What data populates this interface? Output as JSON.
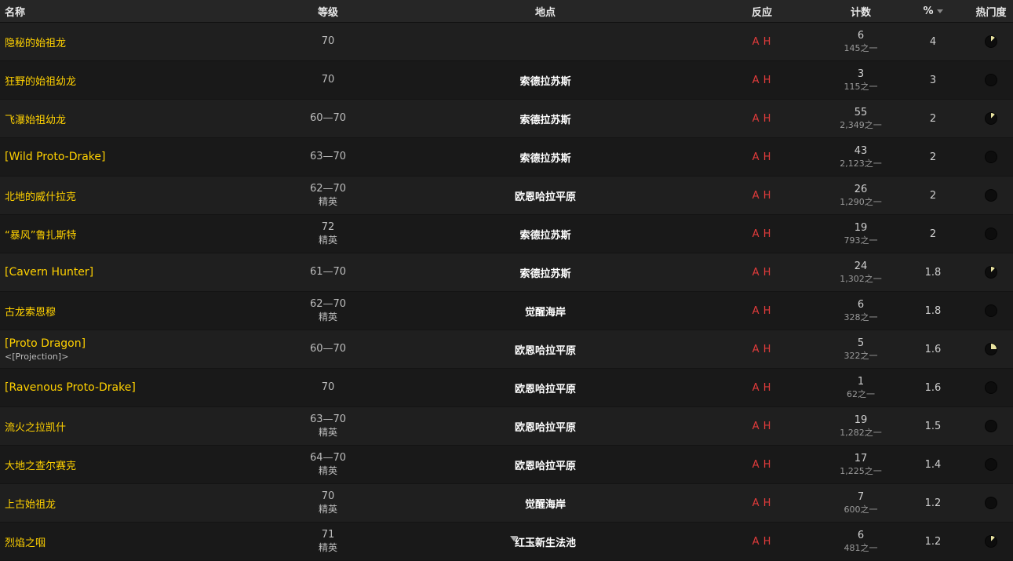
{
  "header": {
    "name": "名称",
    "level": "等级",
    "location": "地点",
    "react": "反应",
    "count": "计数",
    "pct": "%",
    "popularity": "热门度"
  },
  "rows": [
    {
      "name": "隐秘的始祖龙",
      "sub": "",
      "level": "70",
      "level_sub": "",
      "location": "",
      "react_a": "A",
      "react_h": "H",
      "count": "6",
      "count_sub": "145之一",
      "pct": "4",
      "pop": 0.12
    },
    {
      "name": "狂野的始祖幼龙",
      "sub": "",
      "level": "70",
      "level_sub": "",
      "location": "索德拉苏斯",
      "react_a": "A",
      "react_h": "H",
      "count": "3",
      "count_sub": "115之一",
      "pct": "3",
      "pop": 0
    },
    {
      "name": "飞瀑始祖幼龙",
      "sub": "",
      "level": "60—70",
      "level_sub": "",
      "location": "索德拉苏斯",
      "react_a": "A",
      "react_h": "H",
      "count": "55",
      "count_sub": "2,349之一",
      "pct": "2",
      "pop": 0.12
    },
    {
      "name": "[Wild Proto-Drake]",
      "sub": "",
      "level": "63—70",
      "level_sub": "",
      "location": "索德拉苏斯",
      "react_a": "A",
      "react_h": "H",
      "count": "43",
      "count_sub": "2,123之一",
      "pct": "2",
      "pop": 0
    },
    {
      "name": "北地的威什拉克",
      "sub": "",
      "level": "62—70",
      "level_sub": "精英",
      "location": "欧恩哈拉平原",
      "react_a": "A",
      "react_h": "H",
      "count": "26",
      "count_sub": "1,290之一",
      "pct": "2",
      "pop": 0
    },
    {
      "name": "“暴风”鲁扎斯特",
      "sub": "",
      "level": "72",
      "level_sub": "精英",
      "location": "索德拉苏斯",
      "react_a": "A",
      "react_h": "H",
      "count": "19",
      "count_sub": "793之一",
      "pct": "2",
      "pop": 0
    },
    {
      "name": "[Cavern Hunter]",
      "sub": "",
      "level": "61—70",
      "level_sub": "",
      "location": "索德拉苏斯",
      "react_a": "A",
      "react_h": "H",
      "count": "24",
      "count_sub": "1,302之一",
      "pct": "1.8",
      "pop": 0.12
    },
    {
      "name": "古龙索恩穆",
      "sub": "",
      "level": "62—70",
      "level_sub": "精英",
      "location": "觉醒海岸",
      "react_a": "A",
      "react_h": "H",
      "count": "6",
      "count_sub": "328之一",
      "pct": "1.8",
      "pop": 0
    },
    {
      "name": "[Proto Dragon]",
      "sub": "<[Projection]>",
      "level": "60—70",
      "level_sub": "",
      "location": "欧恩哈拉平原",
      "react_a": "A",
      "react_h": "H",
      "count": "5",
      "count_sub": "322之一",
      "pct": "1.6",
      "pop": 0.25
    },
    {
      "name": "[Ravenous Proto-Drake]",
      "sub": "",
      "level": "70",
      "level_sub": "",
      "location": "欧恩哈拉平原",
      "react_a": "A",
      "react_h": "H",
      "count": "1",
      "count_sub": "62之一",
      "pct": "1.6",
      "pop": 0
    },
    {
      "name": "流火之拉凯什",
      "sub": "",
      "level": "63—70",
      "level_sub": "精英",
      "location": "欧恩哈拉平原",
      "react_a": "A",
      "react_h": "H",
      "count": "19",
      "count_sub": "1,282之一",
      "pct": "1.5",
      "pop": 0
    },
    {
      "name": "大地之查尔赛克",
      "sub": "",
      "level": "64—70",
      "level_sub": "精英",
      "location": "欧恩哈拉平原",
      "react_a": "A",
      "react_h": "H",
      "count": "17",
      "count_sub": "1,225之一",
      "pct": "1.4",
      "pop": 0
    },
    {
      "name": "上古始祖龙",
      "sub": "",
      "level": "70",
      "level_sub": "精英",
      "location": "觉醒海岸",
      "react_a": "A",
      "react_h": "H",
      "count": "7",
      "count_sub": "600之一",
      "pct": "1.2",
      "pop": 0
    },
    {
      "name": "烈焰之咽",
      "sub": "",
      "level": "71",
      "level_sub": "精英",
      "location": "红玉新生法池",
      "react_a": "A",
      "react_h": "H",
      "count": "6",
      "count_sub": "481之一",
      "pct": "1.2",
      "pop": 0.12
    }
  ],
  "colors": {
    "name_link": "#ffd100",
    "react": "#e03b3b",
    "pie_fill": "#e8e2a0",
    "pie_bg": "#0d0d0d"
  }
}
